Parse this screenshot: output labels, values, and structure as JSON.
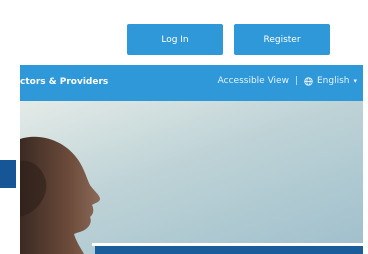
{
  "header": {
    "login_label": "Log In",
    "register_label": "Register"
  },
  "nav": {
    "left_link": "ctors & Providers",
    "accessible_view": "Accessible View",
    "separator": "|",
    "language": "English",
    "language_icon": "globe-icon",
    "language_caret": "▾"
  },
  "colors": {
    "primary_blue": "#2f98d8",
    "dark_blue": "#165696"
  }
}
